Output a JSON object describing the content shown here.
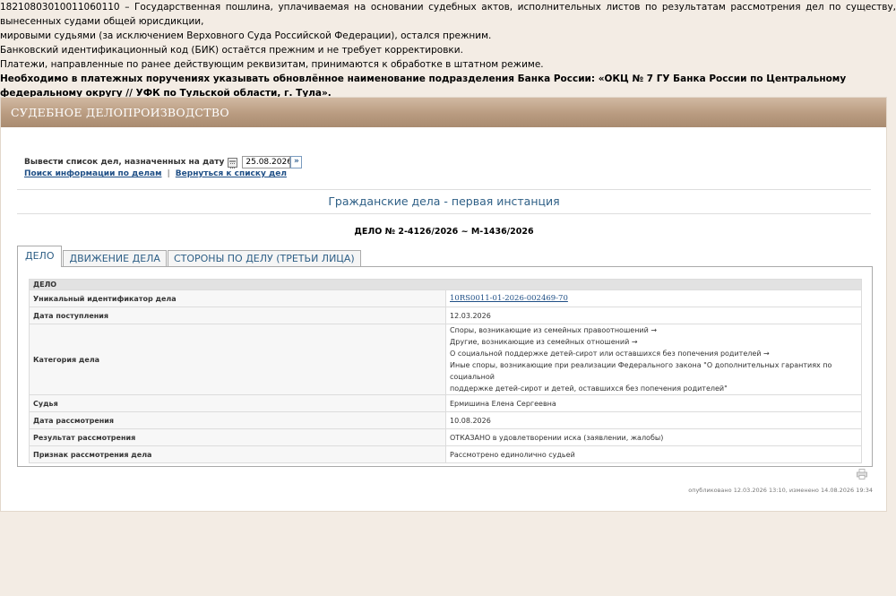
{
  "notice": {
    "line1": "18210803010011060110 – Государственная пошлина, уплачиваемая на основании судебных актов, исполнительных листов по результатам рассмотрения дел по существу, вынесенных судами общей юрисдикции,",
    "line2": "мировыми судьями (за исключением Верховного Суда Российской Федерации), остался прежним.",
    "line3": "Банковский идентификационный код (БИК) остаётся прежним и не требует корректировки.",
    "line4": "Платежи, направленные по ранее действующим реквизитам, принимаются к обработке в штатном режиме.",
    "line5": "Необходимо в платежных поручениях указывать обновлённое наименование подразделения Банка России: «ОКЦ № 7 ГУ Банка России по Центральному федеральному округу // УФК по Тульской области, г. Тула»."
  },
  "panel": {
    "title": "СУДЕБНОЕ ДЕЛОПРОИЗВОДСТВО",
    "date_label": "Вывести список дел, назначенных на дату",
    "date_value": "25.08.2026",
    "go_label": "»",
    "link_search": "Поиск информации по делам",
    "link_sep": "|",
    "link_back": "Вернуться к списку дел",
    "instance_title": "Гражданские дела - первая инстанция",
    "case_title": "ДЕЛО № 2-4126/2026 ~ М-1436/2026"
  },
  "tabs": [
    {
      "label": "ДЕЛО"
    },
    {
      "label": "ДВИЖЕНИЕ ДЕЛА"
    },
    {
      "label": "СТОРОНЫ ПО ДЕЛУ (ТРЕТЬИ ЛИЦА)"
    }
  ],
  "case_table": {
    "header": "ДЕЛО",
    "uid_label": "Уникальный идентификатор дела",
    "uid_value": "10RS0011-01-2026-002469-70",
    "received_label": "Дата поступления",
    "received_value": "12.03.2026",
    "category_label": "Категория дела",
    "category_lines": [
      "Споры, возникающие из семейных правоотношений →",
      "Другие, возникающие из семейных отношений →",
      "О социальной поддержке детей-сирот или оставшихся без попечения родителей →",
      "Иные споры, возникающие при реализации Федерального закона \"О дополнительных гарантиях по социальной",
      "поддержке детей-сирот и детей, оставшихся без попечения родителей\""
    ],
    "judge_label": "Судья",
    "judge_value": "Ермишина Елена Сергеевна",
    "review_date_label": "Дата рассмотрения",
    "review_date_value": "10.08.2026",
    "result_label": "Результат рассмотрения",
    "result_value": "ОТКАЗАНО в удовлетворении иска (заявлении, жалобы)",
    "sign_label": "Признак рассмотрения дела",
    "sign_value": "Рассмотрено единолично судьей"
  },
  "footer": {
    "published": "опубликовано 12.03.2026 13:10, изменено 14.08.2026 19:34"
  }
}
